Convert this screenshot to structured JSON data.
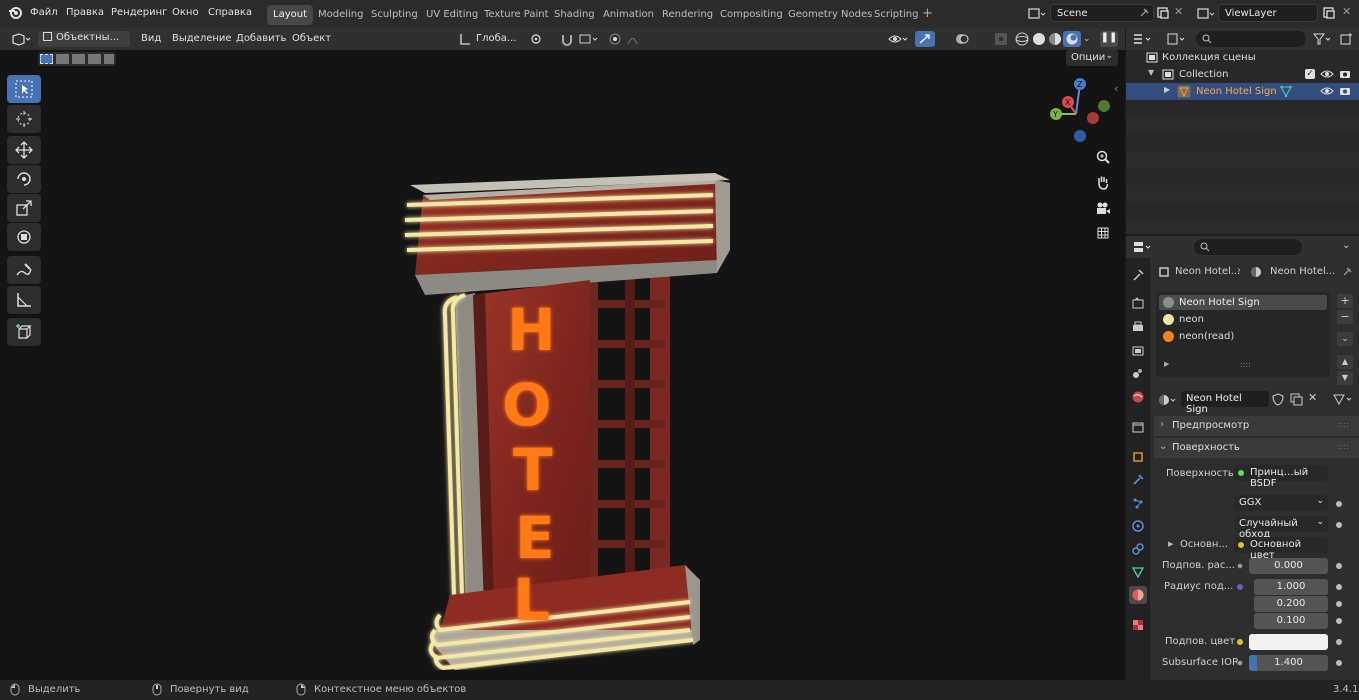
{
  "menu": {
    "file": "Файл",
    "edit": "Правка",
    "render": "Рендеринг",
    "window": "Окно",
    "help": "Справка"
  },
  "workspace_tabs": [
    "Layout",
    "Modeling",
    "Sculpting",
    "UV Editing",
    "Texture Paint",
    "Shading",
    "Animation",
    "Rendering",
    "Compositing",
    "Geometry Nodes",
    "Scripting"
  ],
  "active_tab": "Layout",
  "scene": {
    "name": "Scene",
    "view_layer": "ViewLayer"
  },
  "viewport_header": {
    "mode": "Объектны...",
    "view": "Вид",
    "select": "Выделение",
    "add": "Добавить",
    "object": "Объект",
    "orientation": "Глоба...",
    "options": "Опции"
  },
  "outliner": {
    "scene_collection": "Коллекция сцены",
    "collection": "Collection",
    "object": "Neon Hotel Sign"
  },
  "properties": {
    "breadcrumb_object": "Neon Hotel...",
    "breadcrumb_material": "Neon Hotel...",
    "slots": [
      "Neon Hotel Sign",
      "neon",
      "neon(read)"
    ],
    "slot_colors": [
      "#8c8c8c",
      "#f0e3a6",
      "#f0841e"
    ],
    "material_name": "Neon Hotel Sign",
    "preview_label": "Предпросмотр",
    "surface_panel": "Поверхность",
    "surface_label": "Поверхность",
    "surface_value": "Принц…ый BSDF",
    "distribution": "GGX",
    "subsurface_method": "Случайный обход",
    "base_label": "Основн...",
    "base_value": "Основной цвет",
    "subsurface_label": "Подпов. рас...",
    "subsurface_value": "0.000",
    "radius_label": "Радиус под...",
    "radius_values": [
      "1.000",
      "0.200",
      "0.100"
    ],
    "subsurface_color_label": "Подпов. цвет",
    "ior_label": "Subsurface IOR",
    "ior_value": "1.400",
    "ior_fraction": 0.0
  },
  "status": {
    "select": "Выделить",
    "rotate": "Повернуть вид",
    "context": "Контекстное меню объектов",
    "version": "3.4.1"
  },
  "sign_letters": [
    "H",
    "O",
    "T",
    "E",
    "L"
  ],
  "colors": {
    "accent": "#4772b3",
    "neon_orange": "#ff7a12",
    "neon_cream": "#f5e7a6",
    "rust_red": "#8e2a22"
  }
}
